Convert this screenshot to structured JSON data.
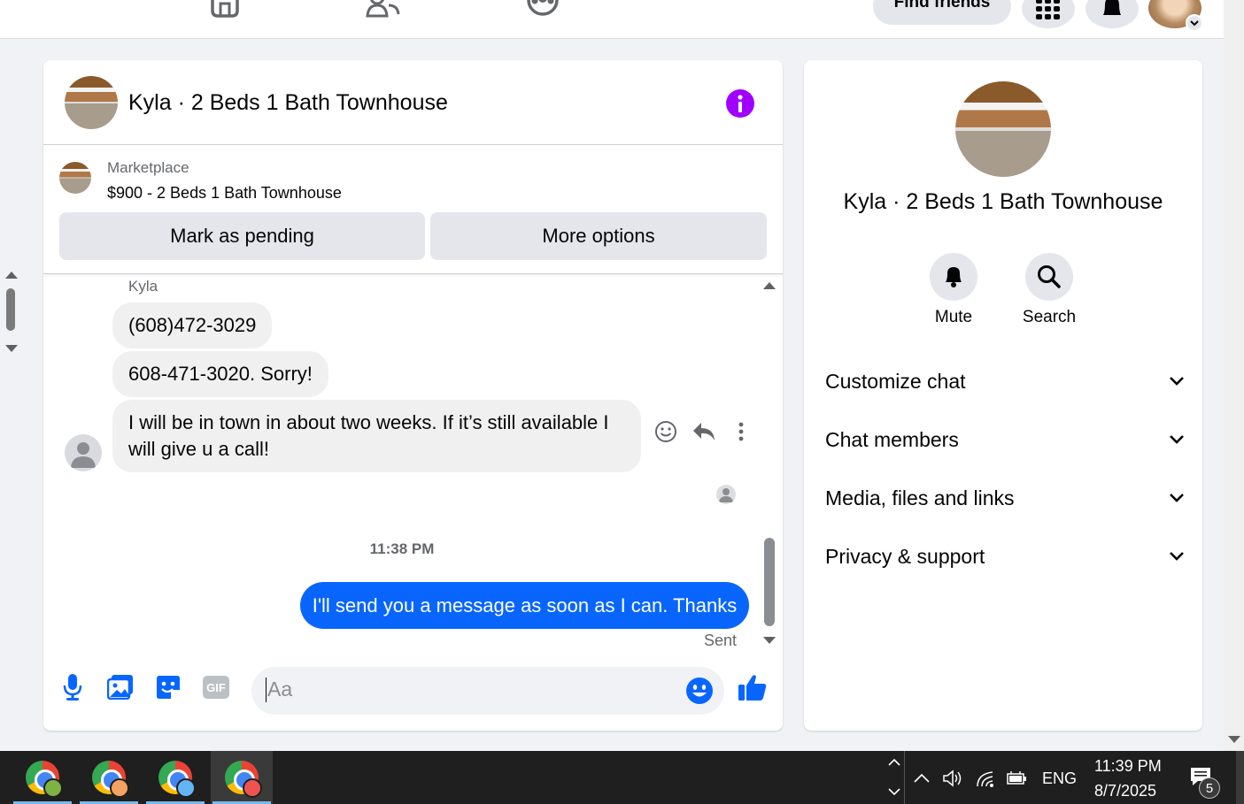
{
  "topnav": {
    "find_friends_label": "Find friends"
  },
  "chat": {
    "title": "Kyla · 2 Beds 1 Bath Townhouse",
    "marketplace_label": "Marketplace",
    "listing_price_title": "$900 - 2 Beds 1 Bath Townhouse",
    "mark_pending_label": "Mark as pending",
    "more_options_label": "More options",
    "sender_name": "Kyla",
    "incoming_messages": [
      "(608)472-3029",
      "608-471-3020. Sorry!",
      "I will be in town in about two weeks. If it’s still available I will give u a call!"
    ],
    "timestamp": "11:38 PM",
    "outgoing_message": "I'll send you a message as soon as I can. Thanks",
    "sent_status": "Sent",
    "composer_placeholder": "Aa",
    "accent_color": "#0866ff",
    "info_color": "#a100ff"
  },
  "info_panel": {
    "title": "Kyla · 2 Beds 1 Bath Townhouse",
    "actions": [
      {
        "label": "Mute",
        "icon": "bell-icon"
      },
      {
        "label": "Search",
        "icon": "search-icon"
      }
    ],
    "sections": [
      "Customize chat",
      "Chat members",
      "Media, files and links",
      "Privacy & support"
    ]
  },
  "taskbar": {
    "language": "ENG",
    "time": "11:39 PM",
    "date": "8/7/2025",
    "notification_count": "5"
  }
}
